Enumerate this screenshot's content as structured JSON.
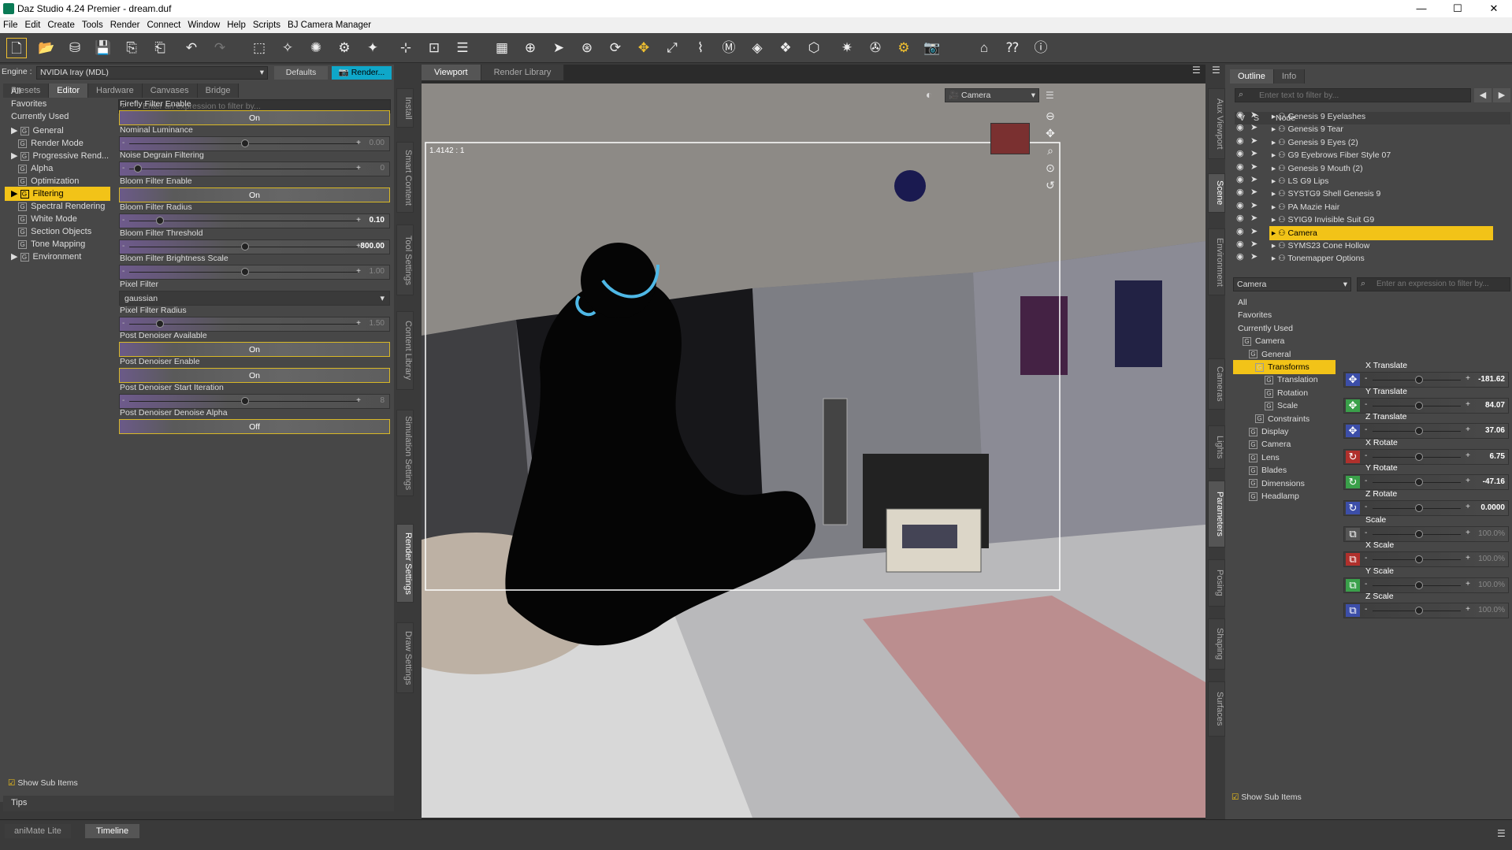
{
  "window": {
    "title": "Daz Studio 4.24 Premier - dream.duf",
    "min": "—",
    "max": "☐",
    "close": "✕"
  },
  "menu": [
    "File",
    "Edit",
    "Create",
    "Tools",
    "Render",
    "Connect",
    "Window",
    "Help",
    "Scripts",
    "BJ Camera Manager"
  ],
  "render_settings": {
    "engine_label": "Engine :",
    "engine_value": "NVIDIA Iray (MDL)",
    "defaults": "Defaults",
    "render": "Render...",
    "tabs": [
      "Presets",
      "Editor",
      "Hardware",
      "Canvases",
      "Bridge"
    ],
    "filter_placeholder": "Enter an expression to filter by...",
    "categories": [
      "All",
      "Favorites",
      "Currently Used",
      "General",
      "Render Mode",
      "Progressive Rend...",
      "Alpha",
      "Optimization",
      "Filtering",
      "Spectral Rendering",
      "White Mode",
      "Section Objects",
      "Tone Mapping",
      "Environment"
    ],
    "properties": [
      {
        "label": "Firefly Filter Enable",
        "type": "button",
        "value": "On"
      },
      {
        "label": "Nominal Luminance",
        "type": "slider",
        "value": "0.00",
        "dim": true,
        "pos": 0.5
      },
      {
        "label": "Noise Degrain Filtering",
        "type": "slider",
        "value": "0",
        "dim": true,
        "pos": 0.02
      },
      {
        "label": "Bloom Filter Enable",
        "type": "button",
        "value": "On"
      },
      {
        "label": "Bloom Filter Radius",
        "type": "slider",
        "value": "0.10",
        "dim": false,
        "pos": 0.12
      },
      {
        "label": "Bloom Filter Threshold",
        "type": "slider",
        "value": "800.00",
        "dim": false,
        "pos": 0.5
      },
      {
        "label": "Bloom Filter Brightness Scale",
        "type": "slider",
        "value": "1.00",
        "dim": true,
        "pos": 0.5
      },
      {
        "label": "Pixel Filter",
        "type": "dropdown",
        "value": "gaussian"
      },
      {
        "label": "Pixel Filter Radius",
        "type": "slider",
        "value": "1.50",
        "dim": true,
        "pos": 0.12
      },
      {
        "label": "Post Denoiser Available",
        "type": "button",
        "value": "On"
      },
      {
        "label": "Post Denoiser Enable",
        "type": "button",
        "value": "On"
      },
      {
        "label": "Post Denoiser Start Iteration",
        "type": "slider",
        "value": "8",
        "dim": true,
        "pos": 0.5
      },
      {
        "label": "Post Denoiser Denoise Alpha",
        "type": "button",
        "value": "Off"
      }
    ],
    "show_sub_items": "Show Sub Items",
    "tips": "Tips"
  },
  "left_side_tabs": [
    "Install",
    "Smart Content",
    "Tool Settings",
    "Content Library",
    "Simulation Settings",
    "Render Settings",
    "Draw Settings"
  ],
  "viewport": {
    "tabs": [
      "Viewport",
      "Render Library"
    ],
    "camera": "Camera",
    "aspect": "1.4142 : 1"
  },
  "right_side_tabs": [
    "Aux Viewport",
    "Scene",
    "Environment",
    "Cameras",
    "Lights",
    "Parameters",
    "Posing",
    "Shaping",
    "Surfaces"
  ],
  "scene": {
    "tabs": [
      "Outline",
      "Info"
    ],
    "filter_placeholder": "Enter text to filter by...",
    "col_v": "V",
    "col_s": "S",
    "col_node": "Node",
    "nodes": [
      "Genesis 9 Eyelashes",
      "Genesis 9 Tear",
      "Genesis 9 Eyes (2)",
      "G9 Eyebrows Fiber Style 07",
      "Genesis 9 Mouth (2)",
      "LS G9 Lips",
      "SYSTG9 Shell Genesis 9",
      "PA Mazie Hair",
      "SYIG9 Invisible Suit G9",
      "Camera",
      "SYMS23 Cone Hollow",
      "Tonemapper Options"
    ]
  },
  "parameters": {
    "selector": "Camera",
    "filter_placeholder": "Enter an expression to filter by...",
    "tree": [
      "All",
      "Favorites",
      "Currently Used",
      "Camera",
      "General",
      "Transforms",
      "Translation",
      "Rotation",
      "Scale",
      "Constraints",
      "Display",
      "Camera",
      "Lens",
      "Blades",
      "Dimensions",
      "Headlamp"
    ],
    "params": [
      {
        "label": "X Translate",
        "value": "-181.62",
        "dim": false,
        "pos": 0.5,
        "icon": "✥",
        "color": "#3c4ea8"
      },
      {
        "label": "Y Translate",
        "value": "84.07",
        "dim": false,
        "pos": 0.5,
        "icon": "✥",
        "color": "#3aa04a"
      },
      {
        "label": "Z Translate",
        "value": "37.06",
        "dim": false,
        "pos": 0.5,
        "icon": "✥",
        "color": "#3c4ea8"
      },
      {
        "label": "X Rotate",
        "value": "6.75",
        "dim": false,
        "pos": 0.5,
        "icon": "↻",
        "color": "#b0302c"
      },
      {
        "label": "Y Rotate",
        "value": "-47.16",
        "dim": false,
        "pos": 0.5,
        "icon": "↻",
        "color": "#3aa04a"
      },
      {
        "label": "Z Rotate",
        "value": "0.0000",
        "dim": false,
        "pos": 0.5,
        "icon": "↻",
        "color": "#3c4ea8"
      },
      {
        "label": "Scale",
        "value": "100.0%",
        "dim": true,
        "pos": 0.5,
        "icon": "⧉",
        "color": "#555"
      },
      {
        "label": "X Scale",
        "value": "100.0%",
        "dim": true,
        "pos": 0.5,
        "icon": "⧉",
        "color": "#b0302c"
      },
      {
        "label": "Y Scale",
        "value": "100.0%",
        "dim": true,
        "pos": 0.5,
        "icon": "⧉",
        "color": "#3aa04a"
      },
      {
        "label": "Z Scale",
        "value": "100.0%",
        "dim": true,
        "pos": 0.5,
        "icon": "⧉",
        "color": "#3c4ea8"
      }
    ],
    "show_sub_items": "Show Sub Items"
  },
  "bottom_tabs": [
    "aniMate Lite",
    "Timeline"
  ]
}
